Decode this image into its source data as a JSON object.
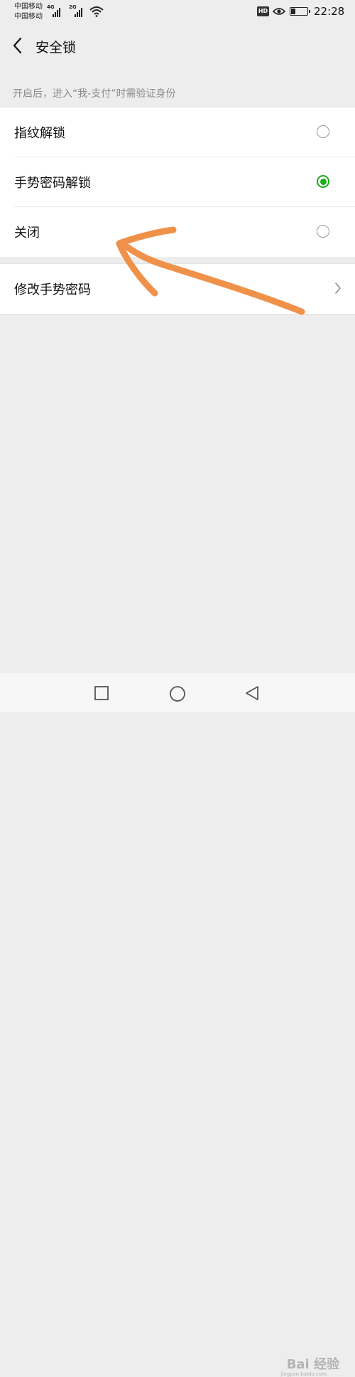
{
  "status": {
    "carrier1": "中国移动",
    "carrier2": "中国移动",
    "net1": "4G",
    "net2": "2G",
    "hd": "HD",
    "time": "22:28",
    "battery_level": 0.3
  },
  "nav": {
    "title": "安全锁",
    "back_icon": "chevron-left-icon"
  },
  "hint": "开启后，进入“我-支付”时需验证身份",
  "options": [
    {
      "label": "指纹解锁",
      "selected": false
    },
    {
      "label": "手势密码解锁",
      "selected": true
    },
    {
      "label": "关闭",
      "selected": false
    }
  ],
  "modify": {
    "label": "修改手势密码",
    "icon": "chevron-right-icon"
  },
  "colors": {
    "accent": "#1aad19",
    "annotation": "#f0914a",
    "background": "#ededed"
  },
  "sysnav": [
    "recents-square-icon",
    "home-circle-icon",
    "back-triangle-icon"
  ],
  "watermark": {
    "text": "Bai 经验",
    "sub": "jingyan.baidu.com"
  }
}
